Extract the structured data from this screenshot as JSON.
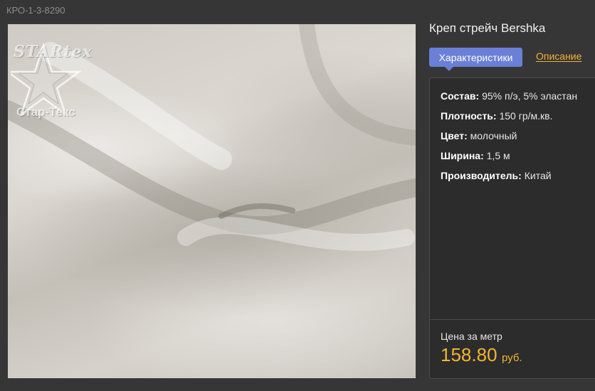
{
  "sku": "КРО-1-3-8290",
  "logo": {
    "brand": "STARtex",
    "caption": "Стар-Текс"
  },
  "product": {
    "title": "Креп стрейч Bershka",
    "tabs": {
      "characteristics": "Характеристики",
      "description": "Описание"
    },
    "specs": [
      {
        "label": "Состав:",
        "value": " 95% п/э, 5% эластан"
      },
      {
        "label": "Плотность:",
        "value": " 150 гр/м.кв."
      },
      {
        "label": "Цвет:",
        "value": " молочный"
      },
      {
        "label": "Ширина:",
        "value": " 1,5 м"
      },
      {
        "label": "Производитель:",
        "value": " Китай"
      }
    ],
    "price": {
      "label": "Цена за метр",
      "value": "158.80",
      "unit": "руб."
    }
  },
  "colors": {
    "accent": "#6a7fd6",
    "price": "#f2b630",
    "link": "#f0b33a",
    "background": "#363636"
  }
}
